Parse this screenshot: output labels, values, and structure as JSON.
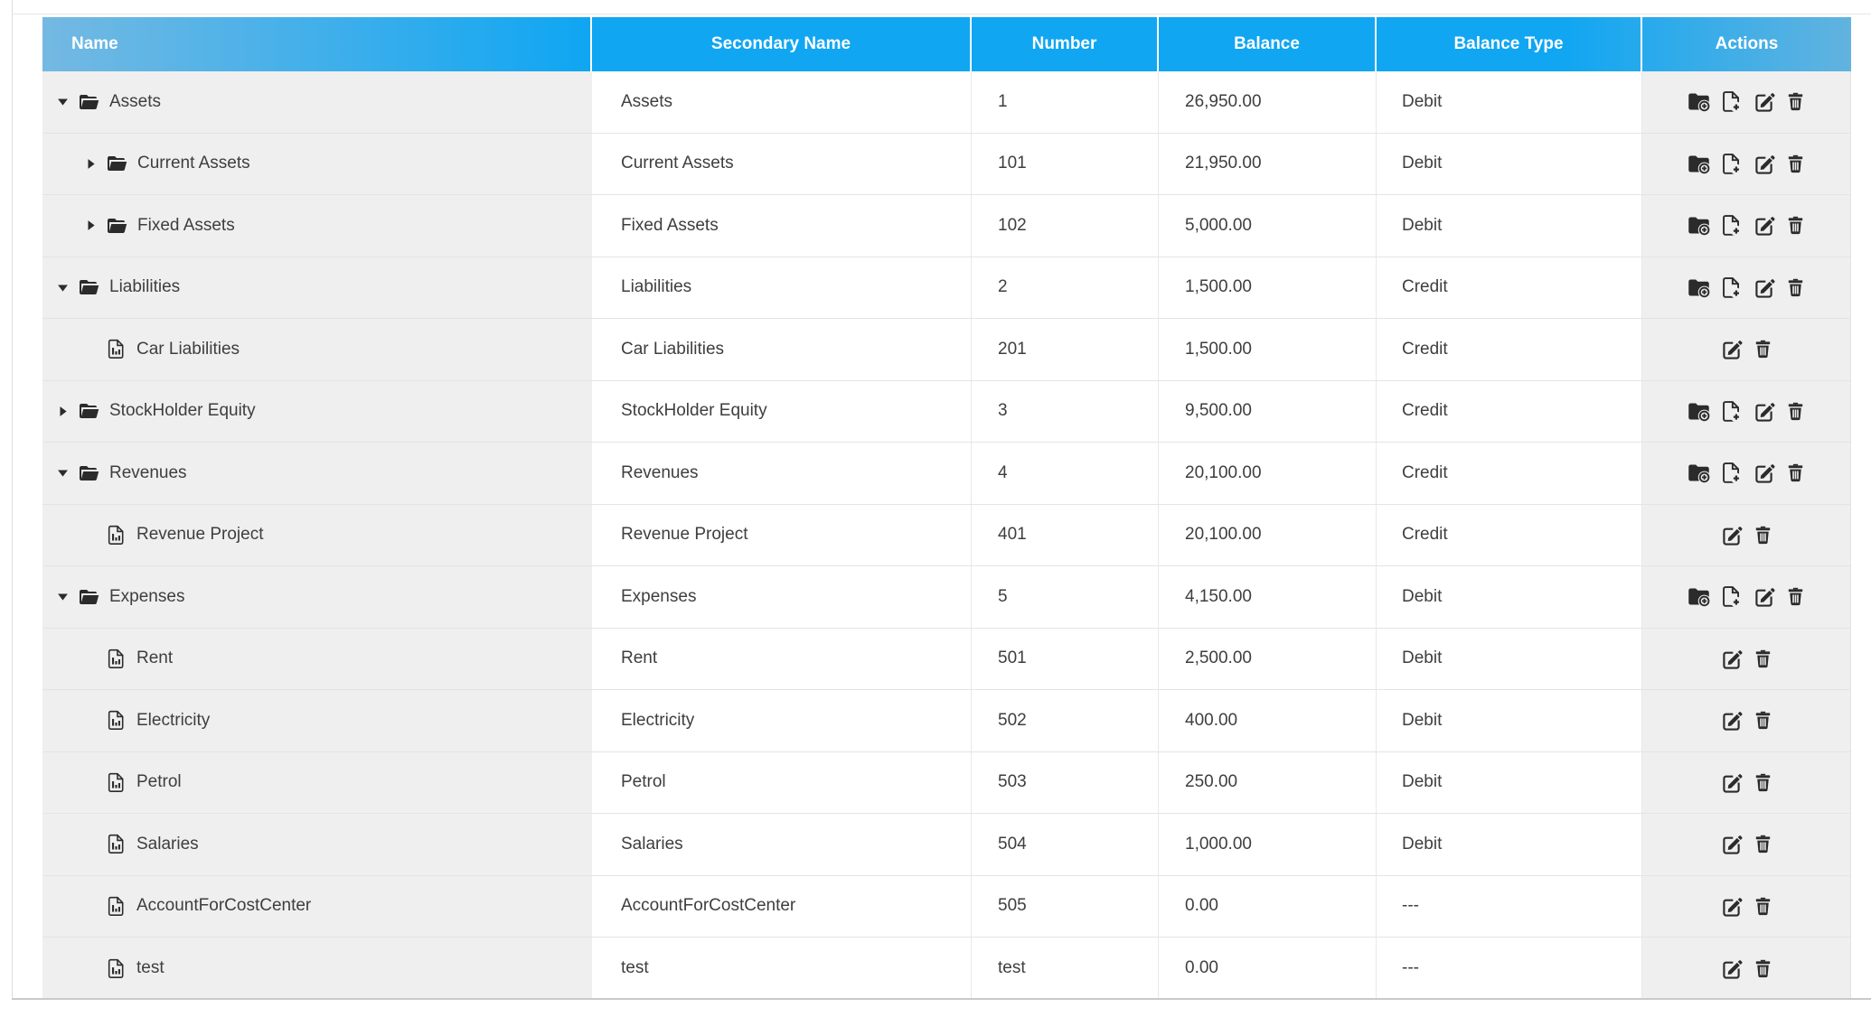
{
  "header": {
    "columns": [
      "Name",
      "Secondary Name",
      "Number",
      "Balance",
      "Balance Type",
      "Actions"
    ]
  },
  "rows": [
    {
      "name": "Assets",
      "secondary_name": "Assets",
      "number": "1",
      "balance": "26,950.00",
      "balance_type": "Debit",
      "node": "folder",
      "state": "expanded",
      "level": 0,
      "actions": [
        "add-folder",
        "add-file",
        "edit",
        "delete"
      ]
    },
    {
      "name": "Current Assets",
      "secondary_name": "Current Assets",
      "number": "101",
      "balance": "21,950.00",
      "balance_type": "Debit",
      "node": "folder",
      "state": "collapsed",
      "level": 1,
      "actions": [
        "add-folder",
        "add-file",
        "edit",
        "delete"
      ]
    },
    {
      "name": "Fixed Assets",
      "secondary_name": "Fixed Assets",
      "number": "102",
      "balance": "5,000.00",
      "balance_type": "Debit",
      "node": "folder",
      "state": "collapsed",
      "level": 1,
      "actions": [
        "add-folder",
        "add-file",
        "edit",
        "delete"
      ]
    },
    {
      "name": "Liabilities",
      "secondary_name": "Liabilities",
      "number": "2",
      "balance": "1,500.00",
      "balance_type": "Credit",
      "node": "folder",
      "state": "expanded",
      "level": 0,
      "actions": [
        "add-folder",
        "add-file",
        "edit",
        "delete"
      ]
    },
    {
      "name": "Car Liabilities",
      "secondary_name": "Car Liabilities",
      "number": "201",
      "balance": "1,500.00",
      "balance_type": "Credit",
      "node": "leaf",
      "state": "none",
      "level": 1,
      "actions": [
        "edit",
        "delete"
      ]
    },
    {
      "name": "StockHolder Equity",
      "secondary_name": "StockHolder Equity",
      "number": "3",
      "balance": "9,500.00",
      "balance_type": "Credit",
      "node": "folder",
      "state": "collapsed",
      "level": 0,
      "actions": [
        "add-folder",
        "add-file",
        "edit",
        "delete"
      ]
    },
    {
      "name": "Revenues",
      "secondary_name": "Revenues",
      "number": "4",
      "balance": "20,100.00",
      "balance_type": "Credit",
      "node": "folder",
      "state": "expanded",
      "level": 0,
      "actions": [
        "add-folder",
        "add-file",
        "edit",
        "delete"
      ]
    },
    {
      "name": "Revenue Project",
      "secondary_name": "Revenue Project",
      "number": "401",
      "balance": "20,100.00",
      "balance_type": "Credit",
      "node": "leaf",
      "state": "none",
      "level": 1,
      "actions": [
        "edit",
        "delete"
      ]
    },
    {
      "name": "Expenses",
      "secondary_name": "Expenses",
      "number": "5",
      "balance": "4,150.00",
      "balance_type": "Debit",
      "node": "folder",
      "state": "expanded",
      "level": 0,
      "actions": [
        "add-folder",
        "add-file",
        "edit",
        "delete"
      ]
    },
    {
      "name": "Rent",
      "secondary_name": "Rent",
      "number": "501",
      "balance": "2,500.00",
      "balance_type": "Debit",
      "node": "leaf",
      "state": "none",
      "level": 1,
      "actions": [
        "edit",
        "delete"
      ]
    },
    {
      "name": "Electricity",
      "secondary_name": "Electricity",
      "number": "502",
      "balance": "400.00",
      "balance_type": "Debit",
      "node": "leaf",
      "state": "none",
      "level": 1,
      "actions": [
        "edit",
        "delete"
      ]
    },
    {
      "name": "Petrol",
      "secondary_name": "Petrol",
      "number": "503",
      "balance": "250.00",
      "balance_type": "Debit",
      "node": "leaf",
      "state": "none",
      "level": 1,
      "actions": [
        "edit",
        "delete"
      ]
    },
    {
      "name": "Salaries",
      "secondary_name": "Salaries",
      "number": "504",
      "balance": "1,000.00",
      "balance_type": "Debit",
      "node": "leaf",
      "state": "none",
      "level": 1,
      "actions": [
        "edit",
        "delete"
      ]
    },
    {
      "name": "AccountForCostCenter",
      "secondary_name": "AccountForCostCenter",
      "number": "505",
      "balance": "0.00",
      "balance_type": "---",
      "node": "leaf",
      "state": "none",
      "level": 1,
      "actions": [
        "edit",
        "delete"
      ]
    },
    {
      "name": "test",
      "secondary_name": "test",
      "number": "test",
      "balance": "0.00",
      "balance_type": "---",
      "node": "leaf",
      "state": "none",
      "level": 1,
      "actions": [
        "edit",
        "delete"
      ]
    }
  ],
  "icons": {
    "caret-down-icon": "solid triangle pointing down (expanded tree node)",
    "caret-right-icon": "solid triangle pointing right (collapsed tree node)",
    "folder-open-icon": "solid open folder (account group)",
    "chart-file-icon": "outlined document with bar chart (ledger account)",
    "folder-plus-icon": "solid folder with plus badge (add sub-folder)",
    "file-plus-icon": "outlined document with plus (add account)",
    "edit-icon": "pencil over square (edit)",
    "trash-icon": "trash can (delete)"
  },
  "colors": {
    "header_gradient_start": "#74b9e2",
    "header_blue": "#10a6f2",
    "header_gradient_end": "#62b3df",
    "row_gray": "#efefef",
    "row_border": "#e4e4e4",
    "icon": "#2b2b2b",
    "text": "#3e3e3e"
  }
}
